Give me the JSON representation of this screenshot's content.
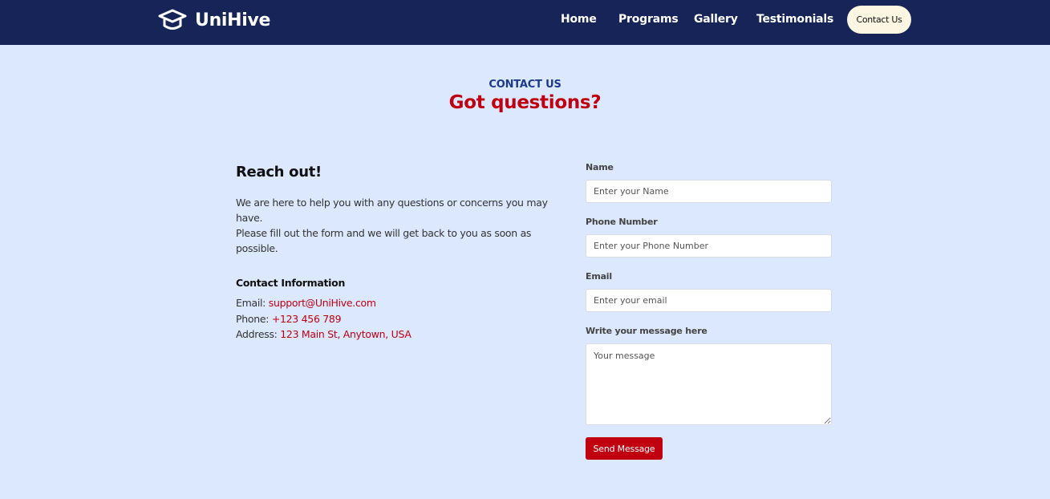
{
  "header": {
    "brand": "UniHive",
    "nav": [
      "Home",
      "Programs",
      "Gallery",
      "Testimonials"
    ],
    "contact_button": "Contact Us"
  },
  "hero": {
    "eyebrow": "CONTACT US",
    "title": "Got questions?"
  },
  "info": {
    "title": "Reach out!",
    "line1": "We are here to help you with any questions or concerns you may have.",
    "line2": "Please fill out the form and we will get back to you as soon as possible.",
    "contact_title": "Contact Information",
    "email_label": "Email:",
    "email_value": "support@UniHive.com",
    "phone_label": "Phone:",
    "phone_value": "+123 456 789",
    "address_label": "Address:",
    "address_value": "123 Main St, Anytown, USA"
  },
  "form": {
    "name_label": "Name",
    "name_placeholder": "Enter your Name",
    "phone_label": "Phone Number",
    "phone_placeholder": "Enter your Phone Number",
    "email_label": "Email",
    "email_placeholder": "Enter your email",
    "message_label": "Write your message here",
    "message_placeholder": "Your message",
    "submit_label": "Send Message"
  },
  "colors": {
    "navbar": "#172457",
    "page_bg": "#dbe8fd",
    "accent_red": "#c00010",
    "eyebrow_blue": "#1d3a8a",
    "pill_bg": "#fdf6e3"
  }
}
